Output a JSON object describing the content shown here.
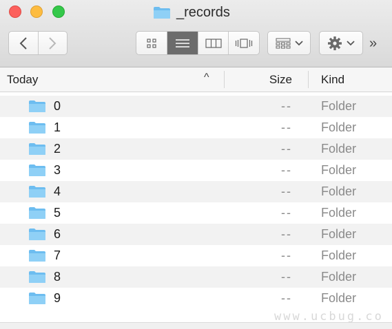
{
  "window": {
    "title": "_records",
    "accent_folder_color": "#78c8f2"
  },
  "toolbar": {
    "back_icon": "chevron-left-icon",
    "forward_icon": "chevron-right-icon",
    "view_modes": [
      "icon-view",
      "list-view",
      "column-view",
      "cover-flow-view"
    ],
    "active_view": "list-view",
    "arrange_icon": "arrange-grid-icon",
    "action_icon": "gear-icon",
    "overflow_label": "»"
  },
  "columns": {
    "name": "Today",
    "size": "Size",
    "kind": "Kind",
    "sort_indicator": "^"
  },
  "files": [
    {
      "name": "0",
      "size": "--",
      "kind": "Folder"
    },
    {
      "name": "1",
      "size": "--",
      "kind": "Folder"
    },
    {
      "name": "2",
      "size": "--",
      "kind": "Folder"
    },
    {
      "name": "3",
      "size": "--",
      "kind": "Folder"
    },
    {
      "name": "4",
      "size": "--",
      "kind": "Folder"
    },
    {
      "name": "5",
      "size": "--",
      "kind": "Folder"
    },
    {
      "name": "6",
      "size": "--",
      "kind": "Folder"
    },
    {
      "name": "7",
      "size": "--",
      "kind": "Folder"
    },
    {
      "name": "8",
      "size": "--",
      "kind": "Folder"
    },
    {
      "name": "9",
      "size": "--",
      "kind": "Folder"
    }
  ],
  "watermark": "www.ucbug.co"
}
